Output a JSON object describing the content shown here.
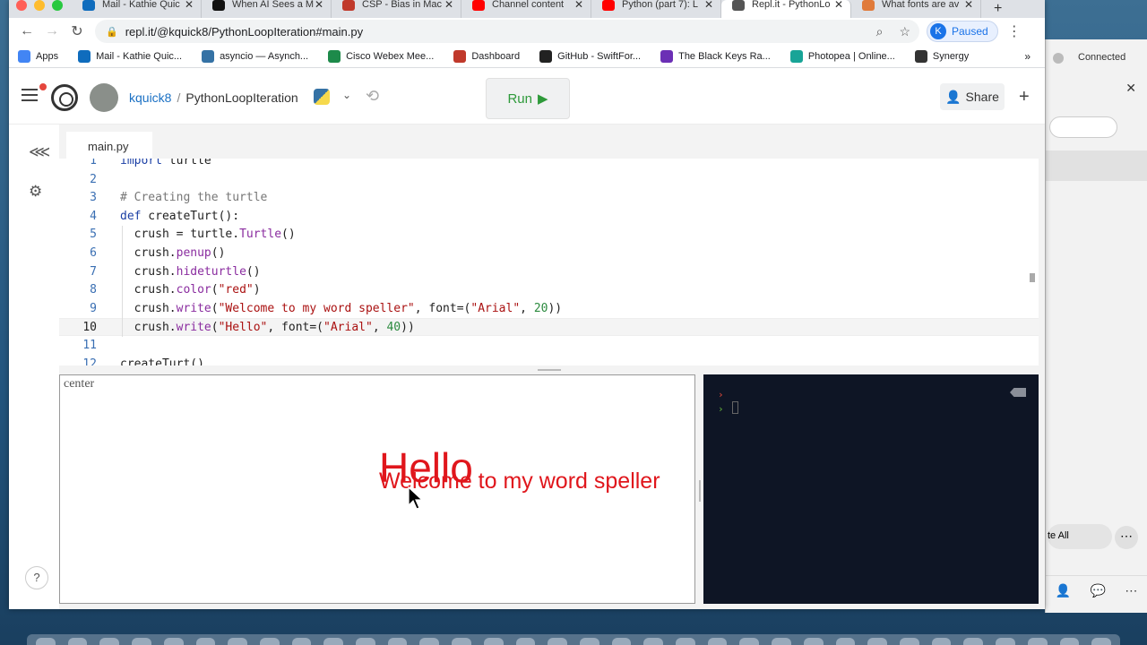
{
  "tabs": [
    {
      "title": "Mail - Kathie Quic",
      "color": "#0f6cbd"
    },
    {
      "title": "When AI Sees a M",
      "color": "#111111"
    },
    {
      "title": "CSP - Bias in Mac",
      "color": "#c0392b"
    },
    {
      "title": "Channel content",
      "color": "#ff0000"
    },
    {
      "title": "Python (part 7): L",
      "color": "#ff0000"
    },
    {
      "title": "Repl.it - PythonLo",
      "color": "#555555",
      "active": true
    },
    {
      "title": "What fonts are av",
      "color": "#e07a3a"
    }
  ],
  "address": {
    "url": "repl.it/@kquick8/PythonLoopIteration#main.py",
    "profile_initial": "K",
    "profile_status": "Paused"
  },
  "bookmarks": [
    {
      "label": "Apps",
      "color": "#4285f4"
    },
    {
      "label": "Mail - Kathie Quic...",
      "color": "#0f6cbd"
    },
    {
      "label": "asyncio — Asynch...",
      "color": "#3572a5"
    },
    {
      "label": "Cisco Webex Mee...",
      "color": "#1d8a4a"
    },
    {
      "label": "Dashboard",
      "color": "#c0392b"
    },
    {
      "label": "GitHub - SwiftFor...",
      "color": "#222222"
    },
    {
      "label": "The Black Keys Ra...",
      "color": "#6b2fb5"
    },
    {
      "label": "Photopea | Online...",
      "color": "#18a497"
    },
    {
      "label": "Synergy",
      "color": "#333333"
    }
  ],
  "repl": {
    "user": "kquick8",
    "project": "PythonLoopIteration",
    "run_label": "Run",
    "share_label": "Share",
    "file_tab": "main.py"
  },
  "code_lines": [
    {
      "n": "1",
      "text": "import turtle"
    },
    {
      "n": "2",
      "text": ""
    },
    {
      "n": "3",
      "text": "# Creating the turtle"
    },
    {
      "n": "4",
      "text": "def createTurt():"
    },
    {
      "n": "5",
      "text": "  crush = turtle.Turtle()"
    },
    {
      "n": "6",
      "text": "  crush.penup()"
    },
    {
      "n": "7",
      "text": "  crush.hideturtle()"
    },
    {
      "n": "8",
      "text": "  crush.color(\"red\")"
    },
    {
      "n": "9",
      "text": "  crush.write(\"Welcome to my word speller\", font=(\"Arial\", 20))"
    },
    {
      "n": "10",
      "text": "  crush.write(\"Hello\", font=(\"Arial\", 40))"
    },
    {
      "n": "11",
      "text": ""
    },
    {
      "n": "12",
      "text": "createTurt()"
    }
  ],
  "output": {
    "canvas_label": "center",
    "hello_text": "Hello",
    "welcome_text": "Welcome to my word speller",
    "text_color": "#e0161c"
  },
  "side_panel": {
    "status": "Connected",
    "button": "te All"
  }
}
